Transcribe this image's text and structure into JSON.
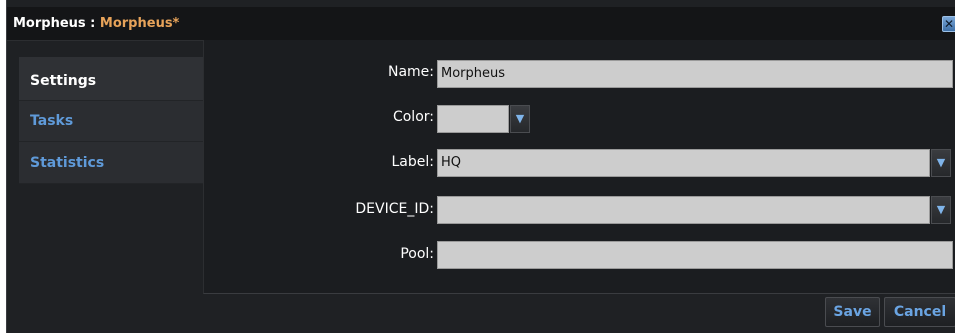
{
  "title": {
    "prefix": "Morpheus : ",
    "name": "Morpheus*"
  },
  "close_icon": "close-icon",
  "sidebar": {
    "items": [
      {
        "label": "Settings",
        "active": true
      },
      {
        "label": "Tasks",
        "active": false
      },
      {
        "label": "Statistics",
        "active": false
      }
    ]
  },
  "form": {
    "name": {
      "label": "Name:",
      "value": "Morpheus"
    },
    "color": {
      "label": "Color:",
      "value": ""
    },
    "label_field": {
      "label": "Label:",
      "value": "HQ"
    },
    "device_id": {
      "label": "DEVICE_ID:",
      "value": ""
    },
    "pool": {
      "label": "Pool:",
      "value": ""
    }
  },
  "footer": {
    "save_label": "Save",
    "cancel_label": "Cancel"
  },
  "colors": {
    "accent": "#e7a35a",
    "link": "#5f9ad9",
    "background": "#1f2124"
  }
}
